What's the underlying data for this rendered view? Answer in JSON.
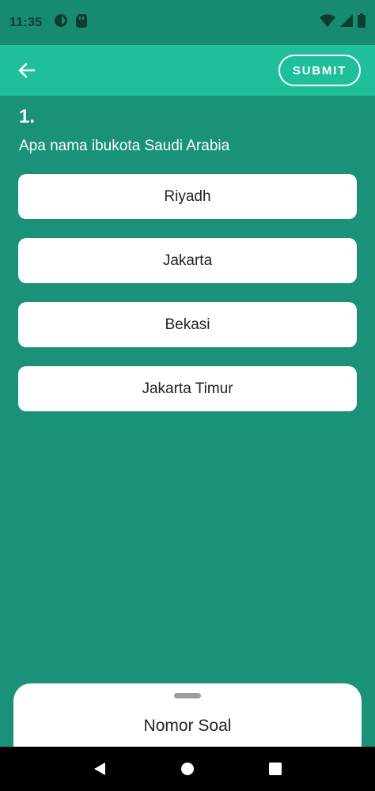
{
  "status_bar": {
    "time": "11:35",
    "icons_left": [
      "opera-icon",
      "sim-card-icon"
    ],
    "icons_right": [
      "wifi-icon",
      "signal-icon",
      "battery-icon"
    ]
  },
  "app_bar": {
    "submit_label": "SUBMIT",
    "back_icon": "back-arrow-icon"
  },
  "question": {
    "number": "1.",
    "text": "Apa nama ibukota Saudi Arabia"
  },
  "options": [
    {
      "label": "Riyadh"
    },
    {
      "label": "Jakarta"
    },
    {
      "label": "Bekasi"
    },
    {
      "label": "Jakarta Timur"
    }
  ],
  "bottom_sheet": {
    "title": "Nomor Soal"
  },
  "colors": {
    "background": "#1a9179",
    "app_bar": "#1fbf9b",
    "status_bar": "#178a72",
    "option_bg": "#ffffff"
  }
}
